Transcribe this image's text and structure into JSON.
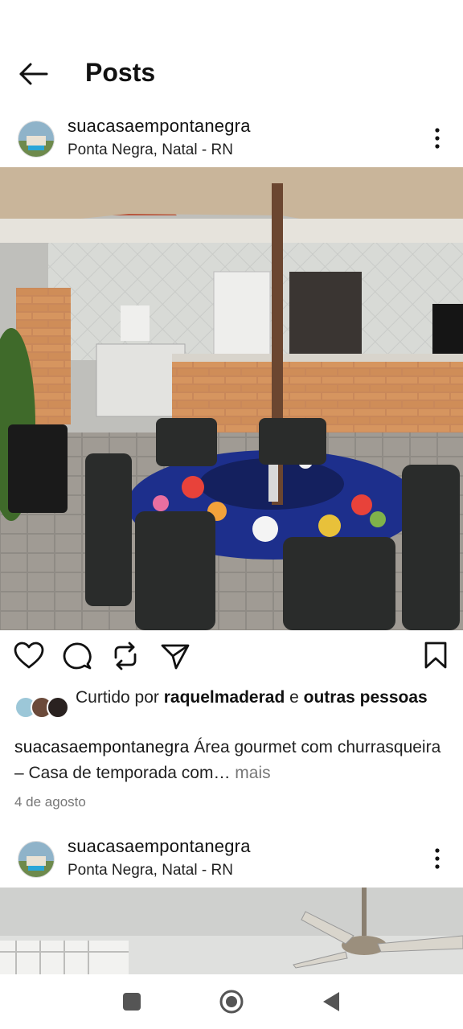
{
  "header": {
    "title": "Posts",
    "back_icon": "arrow-left-icon"
  },
  "posts": [
    {
      "username": "suacasaempontanegra",
      "location": "Ponta Negra, Natal - RN",
      "liked_by_prefix": "Curtido por",
      "liked_by_user": "raquelmaderad",
      "liked_by_joiner": " e ",
      "liked_by_suffix": "outras pessoas",
      "caption_user": "suacasaempontanegra",
      "caption_text": "Área gourmet com churrasqueira – Casa de temporada com…",
      "caption_more": " mais",
      "date": "4 de agosto"
    },
    {
      "username": "suacasaempontanegra",
      "location": "Ponta Negra, Natal - RN"
    }
  ],
  "actions": [
    "heart-icon",
    "comment-icon",
    "repost-icon",
    "share-icon",
    "bookmark-icon"
  ],
  "system_nav": [
    "recent-apps-icon",
    "home-icon",
    "back-icon"
  ],
  "colors": {
    "text": "#111111",
    "muted": "#777777",
    "background": "#ffffff"
  }
}
